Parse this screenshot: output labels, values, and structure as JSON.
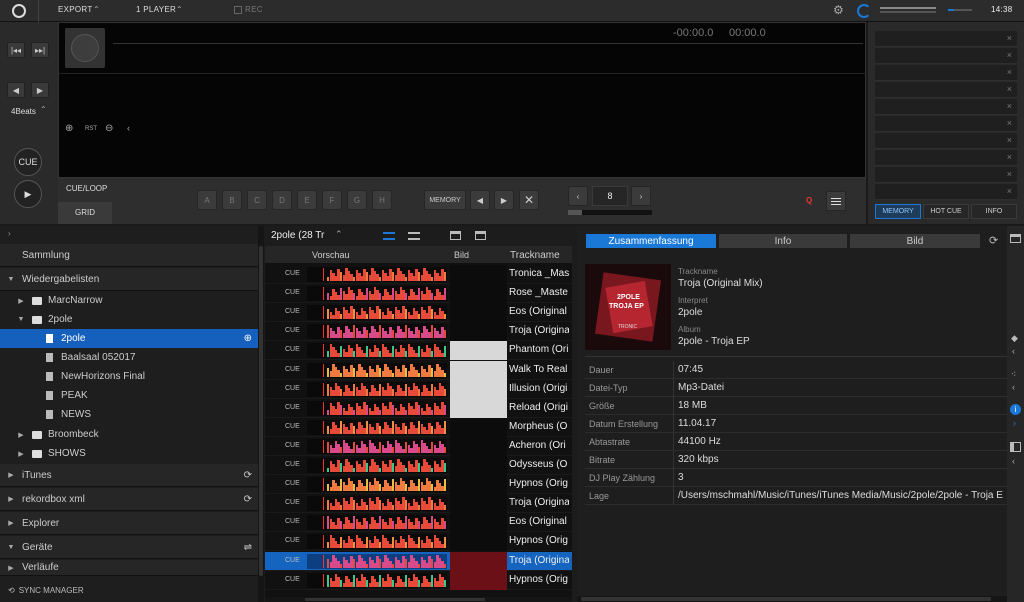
{
  "topbar": {
    "mode": "EXPORT",
    "player": "1 PLAYER",
    "rec": "REC",
    "time": "14:38"
  },
  "deck": {
    "time_remaining": "-00:00.0",
    "time_elapsed": "00:00.0",
    "beats_label": "4Beats",
    "rst": "RST",
    "cue_button": "CUE",
    "cue_loop_tab": "CUE/LOOP",
    "grid_tab": "GRID",
    "pads": [
      "A",
      "B",
      "C",
      "D",
      "E",
      "F",
      "G",
      "H"
    ],
    "memory_button": "MEMORY",
    "loop_beats": "8",
    "q": "Q"
  },
  "memory_panel": {
    "tabs": [
      "MEMORY",
      "HOT CUE",
      "INFO"
    ],
    "close_glyph": "×"
  },
  "tree": {
    "collection": "Sammlung",
    "playlists": "Wiedergabelisten",
    "items": [
      {
        "label": "MarcNarrow",
        "type": "folder",
        "level": 1,
        "expanded": false
      },
      {
        "label": "2pole",
        "type": "folder",
        "level": 1,
        "expanded": true
      },
      {
        "label": "2pole",
        "type": "playlist",
        "level": 2,
        "selected": true
      },
      {
        "label": "Baalsaal 052017",
        "type": "playlist",
        "level": 2
      },
      {
        "label": "NewHorizons Final",
        "type": "playlist",
        "level": 2
      },
      {
        "label": "PEAK",
        "type": "playlist",
        "level": 2
      },
      {
        "label": "NEWS",
        "type": "playlist",
        "level": 2
      },
      {
        "label": "Broombeck",
        "type": "folder",
        "level": 1,
        "expanded": false
      },
      {
        "label": "SHOWS",
        "type": "folder",
        "level": 1,
        "expanded": false
      }
    ],
    "itunes": "iTunes",
    "rekordbox_xml": "rekordbox xml",
    "explorer": "Explorer",
    "devices": "Geräte",
    "history": "Verläufe",
    "sync_manager": "SYNC MANAGER"
  },
  "tracklist": {
    "title": "2pole (28 Tr",
    "col_preview": "Vorschau",
    "col_art": "Bild",
    "col_name": "Trackname",
    "cue_label": "CUE",
    "rows": [
      "Tronica _Mas",
      "Rose _Maste",
      "Eos (Original",
      "Troja (Origina",
      "Phantom (Ori",
      "Walk To Real",
      "Illusion (Origi",
      "Reload (Origi",
      "Morpheus (O",
      "Acheron (Ori",
      "Odysseus (O",
      "Hypnos (Orig",
      "Troja (Origina",
      "Eos (Original",
      "Hypnos (Orig",
      "Troja (Origina",
      "Hypnos (Orig"
    ],
    "selected_index": 15
  },
  "info": {
    "tabs": [
      "Zusammenfassung",
      "Info",
      "Bild"
    ],
    "trackname_label": "Trackname",
    "trackname": "Troja (Original Mix)",
    "artist_label": "Interpret",
    "artist": "2pole",
    "album_label": "Album",
    "album": "2pole - Troja EP",
    "art_text_1": "2POLE",
    "art_text_2": "TROJA EP",
    "art_text_3": "TRONIC",
    "details": [
      {
        "k": "Dauer",
        "v": "07:45"
      },
      {
        "k": "Datei-Typ",
        "v": "Mp3-Datei"
      },
      {
        "k": "Größe",
        "v": "18 MB"
      },
      {
        "k": "Datum Erstellung",
        "v": "11.04.17"
      },
      {
        "k": "Abtastrate",
        "v": "44100 Hz"
      },
      {
        "k": "Bitrate",
        "v": "320 kbps"
      },
      {
        "k": "DJ Play Zählung",
        "v": "3"
      },
      {
        "k": "Lage",
        "v": "/Users/mschmahl/Music/iTunes/iTunes Media/Music/2pole/2pole - Troja E"
      }
    ]
  },
  "colors": {
    "accent": "#1a78d6",
    "selected_row": "#1565c0",
    "wave_red": "#e84a3a",
    "wave_pink": "#e05a9a",
    "wave_green": "#3bc88a"
  }
}
